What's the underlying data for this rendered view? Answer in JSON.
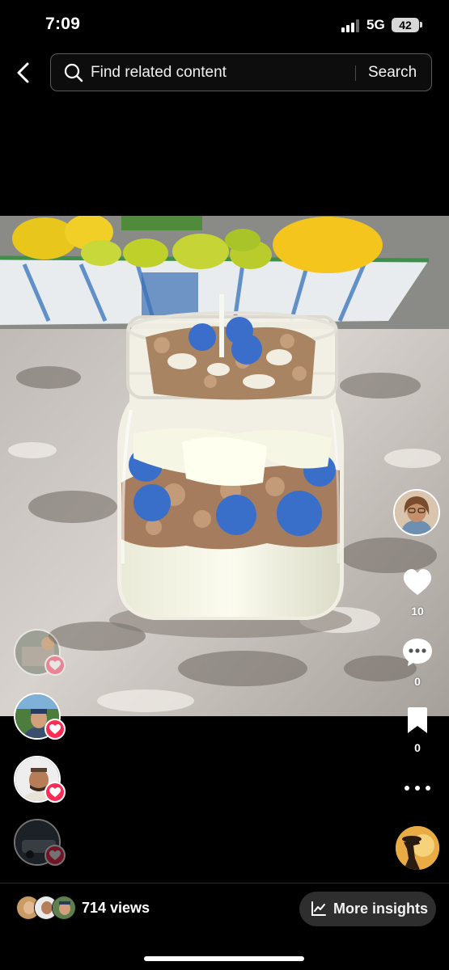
{
  "status_bar": {
    "time": "7:09",
    "network": "5G",
    "battery": "42"
  },
  "header": {
    "search_placeholder": "Find related content",
    "search_button": "Search"
  },
  "actions": {
    "like_count": "10",
    "comment_count": "0",
    "save_count": "0"
  },
  "bottom_bar": {
    "views": "714 views",
    "insights_label": "More insights"
  },
  "colors": {
    "background": "#000000",
    "like_badge": "#fe2c55",
    "search_border": "#5b5b5b",
    "insights_bg": "#2e2e2e"
  },
  "icons": [
    "back-arrow-icon",
    "search-icon",
    "heart-icon",
    "comment-icon",
    "bookmark-icon",
    "more-icon",
    "chart-icon"
  ]
}
